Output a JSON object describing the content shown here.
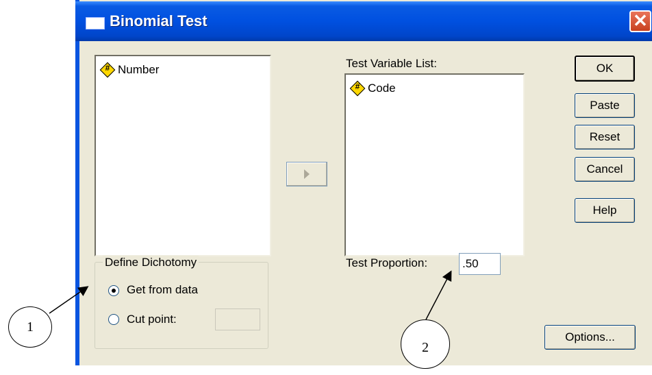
{
  "window": {
    "title": "Binomial Test",
    "close_glyph": "✕"
  },
  "source_list": {
    "items": [
      {
        "label": "Number",
        "icon": "numeric-variable-icon"
      }
    ]
  },
  "move_button": {
    "icon": "right-arrow-icon"
  },
  "test_variable_list": {
    "label": "Test Variable List:",
    "items": [
      {
        "label": "Code",
        "icon": "numeric-variable-icon"
      }
    ]
  },
  "buttons": {
    "ok": "OK",
    "paste": "Paste",
    "reset": "Reset",
    "cancel": "Cancel",
    "help": "Help",
    "options": "Options..."
  },
  "define_dichotomy": {
    "legend": "Define Dichotomy",
    "get_from_data": "Get from data",
    "cut_point": "Cut point:",
    "selected": "get_from_data",
    "cut_point_value": ""
  },
  "test_proportion": {
    "label": "Test Proportion:",
    "value": ".50"
  },
  "callouts": {
    "one": "1",
    "two": "2"
  },
  "colors": {
    "titlebar": "#0050E0",
    "dialog_bg": "#ECE9D8",
    "close": "#D9573C"
  }
}
